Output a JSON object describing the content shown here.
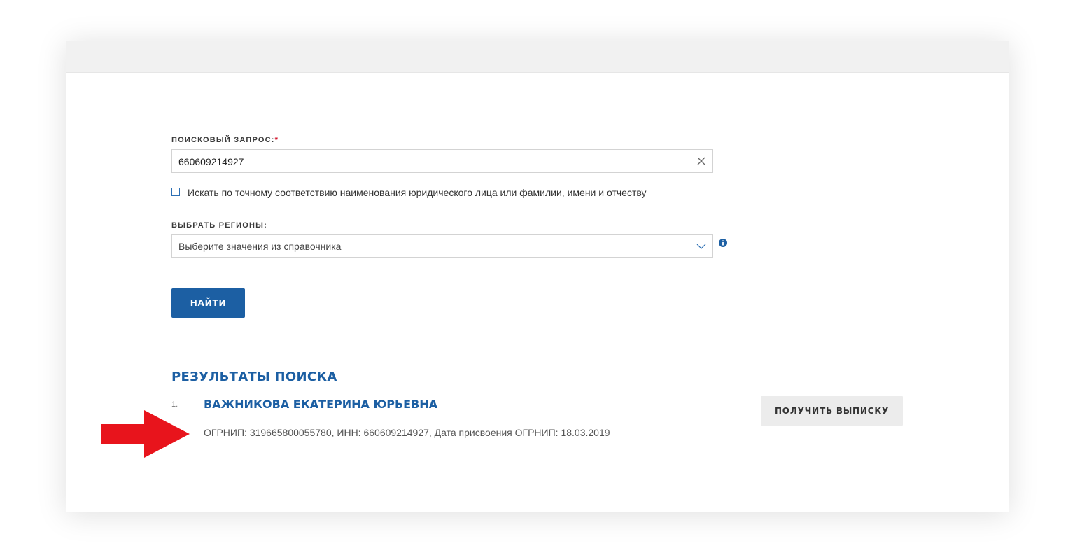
{
  "search": {
    "label": "ПОИСКОВЫЙ ЗАПРОС:",
    "required_mark": "*",
    "value": "660609214927",
    "clear_icon": "close-icon"
  },
  "exact_match": {
    "checked": false,
    "label": "Искать по точному соответствию наименования юридического лица или фамилии, имени и отчеству"
  },
  "regions": {
    "label": "ВЫБРАТЬ РЕГИОНЫ:",
    "placeholder": "Выберите значения из справочника",
    "chevron_icon": "chevron-down-icon",
    "info_icon": "info-icon"
  },
  "find_button": {
    "label": "НАЙТИ"
  },
  "results": {
    "title": "РЕЗУЛЬТАТЫ ПОИСКА",
    "items": [
      {
        "number": "1.",
        "name": "ВАЖНИКОВА ЕКАТЕРИНА ЮРЬЕВНА",
        "details": "ОГРНИП: 319665800055780, ИНН: 660609214927, Дата присвоения ОГРНИП: 18.03.2019",
        "action_label": "ПОЛУЧИТЬ ВЫПИСКУ"
      }
    ]
  },
  "colors": {
    "primary": "#1c5fa3",
    "required": "#d0021b",
    "annotation_arrow": "#e8141c",
    "secondary_button": "#ececec"
  }
}
